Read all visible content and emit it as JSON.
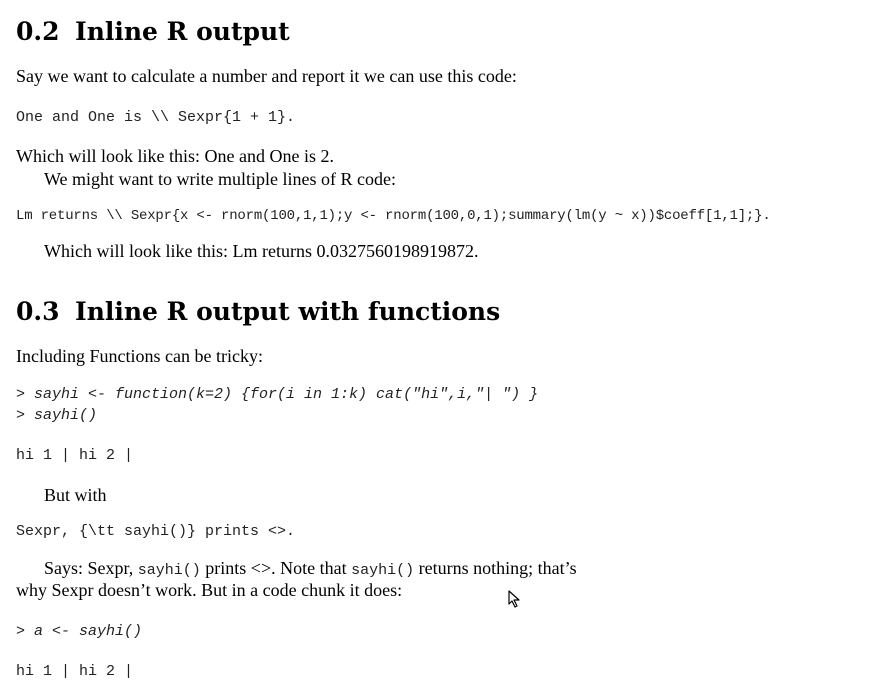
{
  "sec02": {
    "number": "0.2",
    "title": "Inline R output",
    "intro": "Say we want to calculate a number and report it we can use this code:",
    "code1": "One and One is \\\\ Sexpr{1 + 1}.",
    "result1": "Which will look like this: One and One is 2.",
    "para2": "We might want to write multiple lines of R code:",
    "code2": "Lm returns \\\\ Sexpr{x <- rnorm(100,1,1);y <- rnorm(100,0,1);summary(lm(y ~ x))$coeff[1,1];}.",
    "result2": "Which will look like this: Lm returns 0.0327560198919872."
  },
  "sec03": {
    "number": "0.3",
    "title": "Inline R output with functions",
    "intro": "Including Functions can be tricky:",
    "code1_line1": "> sayhi <- function(k=2) {for(i in 1:k) cat(\"hi\",i,\"| \") }",
    "code1_line2": "> sayhi()",
    "output1": "hi 1 | hi 2 |",
    "but_with": "But with",
    "code2": "Sexpr, {\\tt sayhi()} prints <>.",
    "says_a": "Says: Sexpr, ",
    "says_tt1": "sayhi()",
    "says_b": " prints <>. Note that ",
    "says_tt2": "sayhi()",
    "says_c": " returns nothing; that’s",
    "says_line2": "why Sexpr doesn’t work. But in a code chunk it does:",
    "code3": "> a <- sayhi()",
    "output2": "hi 1 | hi 2 |"
  }
}
